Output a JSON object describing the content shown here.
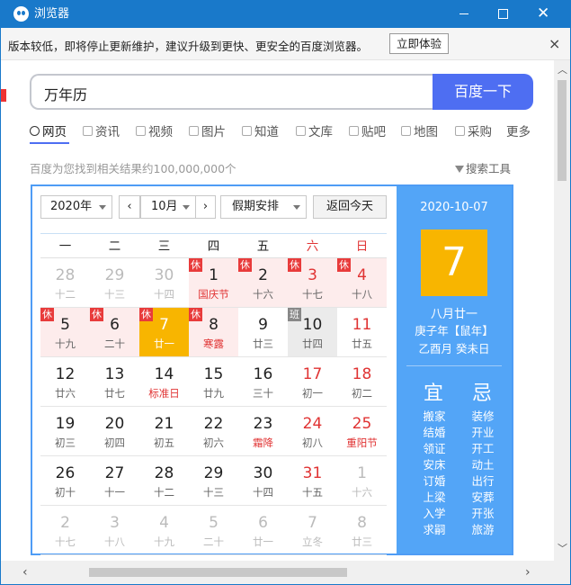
{
  "window": {
    "title": "浏览器",
    "icon": "panda-browser-icon"
  },
  "notice": {
    "text": "版本较低，即将停止更新维护，建议升级到更快、更安全的百度浏览器。",
    "button": "立即体验",
    "close": "×"
  },
  "search": {
    "query": "万年历",
    "button": "百度一下"
  },
  "tabs": [
    {
      "label": "网页",
      "icon": "search-icon"
    },
    {
      "label": "资讯",
      "icon": "news-icon"
    },
    {
      "label": "视频",
      "icon": "video-icon"
    },
    {
      "label": "图片",
      "icon": "image-icon"
    },
    {
      "label": "知道",
      "icon": "question-icon"
    },
    {
      "label": "文库",
      "icon": "doc-icon"
    },
    {
      "label": "贴吧",
      "icon": "tieba-icon"
    },
    {
      "label": "地图",
      "icon": "map-icon"
    },
    {
      "label": "采购",
      "icon": "cart-icon"
    },
    {
      "label": "更多",
      "icon": ""
    }
  ],
  "results": {
    "count_text": "百度为您找到相关结果约100,000,000个",
    "tools": "搜索工具"
  },
  "calendar": {
    "year_select": "2020年",
    "month_select": "10月",
    "prev": "‹",
    "next": "›",
    "holiday_select": "假期安排",
    "today_button": "返回今天",
    "weekdays": [
      "一",
      "二",
      "三",
      "四",
      "五",
      "六",
      "日"
    ],
    "weeks": [
      [
        {
          "d": "28",
          "l": "十二",
          "o": 1
        },
        {
          "d": "29",
          "l": "十三",
          "o": 1
        },
        {
          "d": "30",
          "l": "十四",
          "o": 1
        },
        {
          "d": "1",
          "l": "国庆节",
          "h": 1,
          "t": "休",
          "f": 1
        },
        {
          "d": "2",
          "l": "十六",
          "h": 1,
          "t": "休"
        },
        {
          "d": "3",
          "l": "十七",
          "h": 1,
          "t": "休",
          "w": 1
        },
        {
          "d": "4",
          "l": "十八",
          "h": 1,
          "t": "休",
          "w": 1
        }
      ],
      [
        {
          "d": "5",
          "l": "十九",
          "h": 1,
          "t": "休"
        },
        {
          "d": "6",
          "l": "二十",
          "h": 1,
          "t": "休"
        },
        {
          "d": "7",
          "l": "廿一",
          "today": 1,
          "t": "休"
        },
        {
          "d": "8",
          "l": "寒露",
          "h": 1,
          "t": "休",
          "f": 1
        },
        {
          "d": "9",
          "l": "廿三"
        },
        {
          "d": "10",
          "l": "廿四",
          "wk": 1,
          "t": "班"
        },
        {
          "d": "11",
          "l": "廿五",
          "w": 1
        }
      ],
      [
        {
          "d": "12",
          "l": "廿六"
        },
        {
          "d": "13",
          "l": "廿七"
        },
        {
          "d": "14",
          "l": "标准日",
          "f": 1
        },
        {
          "d": "15",
          "l": "廿九"
        },
        {
          "d": "16",
          "l": "三十"
        },
        {
          "d": "17",
          "l": "初一",
          "w": 1
        },
        {
          "d": "18",
          "l": "初二",
          "w": 1
        }
      ],
      [
        {
          "d": "19",
          "l": "初三"
        },
        {
          "d": "20",
          "l": "初四"
        },
        {
          "d": "21",
          "l": "初五"
        },
        {
          "d": "22",
          "l": "初六"
        },
        {
          "d": "23",
          "l": "霜降",
          "f": 1
        },
        {
          "d": "24",
          "l": "初八",
          "w": 1
        },
        {
          "d": "25",
          "l": "重阳节",
          "w": 1,
          "f": 1
        }
      ],
      [
        {
          "d": "26",
          "l": "初十"
        },
        {
          "d": "27",
          "l": "十一"
        },
        {
          "d": "28",
          "l": "十二"
        },
        {
          "d": "29",
          "l": "十三"
        },
        {
          "d": "30",
          "l": "十四"
        },
        {
          "d": "31",
          "l": "十五",
          "w": 1
        },
        {
          "d": "1",
          "l": "十六",
          "o": 1
        }
      ],
      [
        {
          "d": "2",
          "l": "十七",
          "o": 1
        },
        {
          "d": "3",
          "l": "十八",
          "o": 1
        },
        {
          "d": "4",
          "l": "十九",
          "o": 1
        },
        {
          "d": "5",
          "l": "二十",
          "o": 1
        },
        {
          "d": "6",
          "l": "廿一",
          "o": 1
        },
        {
          "d": "7",
          "l": "立冬",
          "o": 1
        },
        {
          "d": "8",
          "l": "廿三",
          "o": 1
        }
      ]
    ],
    "selected": {
      "date": "2020-10-07",
      "day": "7",
      "lunar": "八月廿一",
      "year_text": "庚子年【鼠年】",
      "ganzhi": "乙酉月 癸未日",
      "yi_label": "宜",
      "ji_label": "忌",
      "yi": [
        "搬家",
        "结婚",
        "领证",
        "安床",
        "订婚",
        "上梁",
        "入学",
        "求嗣"
      ],
      "ji": [
        "装修",
        "开业",
        "开工",
        "动土",
        "出行",
        "安葬",
        "开张",
        "旅游"
      ]
    }
  },
  "colors": {
    "titlebar": "#1979ca",
    "accent": "#4e6ef2",
    "today": "#f8b500",
    "panel": "#53a5f7",
    "holiday_bg": "#fdecec",
    "red": "#e03333"
  }
}
